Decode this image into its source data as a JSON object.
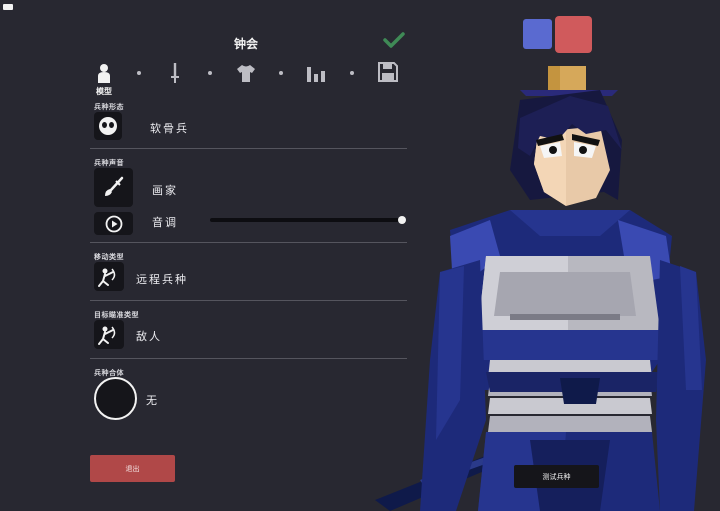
{
  "unit": {
    "name": "钟会"
  },
  "steps": [
    {
      "icon": "person-icon",
      "label": "模型",
      "active": true
    },
    {
      "icon": "sword-icon",
      "label": ""
    },
    {
      "icon": "shirt-icon",
      "label": ""
    },
    {
      "icon": "stats-icon",
      "label": ""
    },
    {
      "icon": "save-icon",
      "label": ""
    }
  ],
  "sections": {
    "base": {
      "label": "兵种形态",
      "value": "软骨兵",
      "icon": "skull-face-icon"
    },
    "voice": {
      "label": "兵种声音",
      "value": "画家",
      "icon": "brush-icon",
      "pitch_label": "音调",
      "pitch_level": 1.0,
      "play_icon": "play-icon"
    },
    "movement": {
      "label": "移动类型",
      "value": "远程兵种",
      "icon": "ranged-unit-icon"
    },
    "targeting": {
      "label": "目标瞄准类型",
      "value": "敌人",
      "icon": "target-unit-icon"
    },
    "combine": {
      "label": "兵种合体",
      "value": "无"
    }
  },
  "buttons": {
    "exit": "退出",
    "test_unit": "测试兵种",
    "confirm_icon": "checkmark-icon"
  },
  "colors": {
    "team_blue": "#5a6ad0",
    "team_red": "#d05a5c",
    "accent_check": "#3f8a56",
    "exit_red": "#b04848"
  }
}
